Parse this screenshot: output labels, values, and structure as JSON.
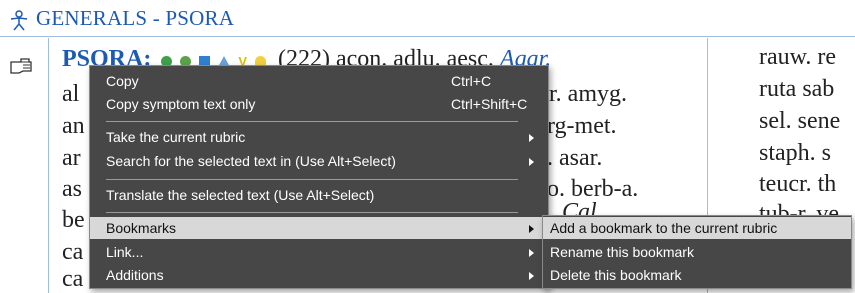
{
  "header": {
    "title": "GENERALS - PSORA",
    "icon": "human-figure-icon",
    "accent": "#1d5ab4"
  },
  "rubric": {
    "name": "PSORA:",
    "count": "(222)",
    "remedies_start": "acon. adlu. aesc.",
    "agar": "Agar."
  },
  "left_lines": {
    "l1_prefix": "al",
    "l1_suffix": "or. amyg.",
    "l2_prefix": "an",
    "l2_suffix": "rg-met.",
    "l3_prefix": "ar",
    "l3_suffix": ". asar.",
    "l4_prefix": "as",
    "l4_suffix": "o. berb-a.",
    "l5_prefix": "be",
    "l5_suffix": "Cal",
    "l6_prefix": "ca",
    "l7_prefix": "ca"
  },
  "right_lines": [
    "rauw. re",
    "ruta sab",
    "sel. sene",
    "staph. s",
    "teucr. th",
    "tub-r. ve"
  ],
  "context_menu": {
    "items": [
      {
        "label": "Copy",
        "shortcut": "Ctrl+C"
      },
      {
        "label": "Copy symptom text only",
        "shortcut": "Ctrl+Shift+C"
      },
      {
        "label": "Take the current rubric"
      },
      {
        "label": "Search for the selected text in (Use Alt+Select)"
      },
      {
        "label": "Translate the selected text (Use Alt+Select)"
      },
      {
        "label": "Bookmarks"
      },
      {
        "label": "Link..."
      },
      {
        "label": "Additions"
      }
    ]
  },
  "submenu": {
    "items": [
      {
        "label": "Add a bookmark to the current rubric"
      },
      {
        "label": "Rename this bookmark"
      },
      {
        "label": "Delete this bookmark"
      }
    ]
  },
  "colors": {
    "menu_bg": "#474747",
    "menu_highlight": "#d8d8d8",
    "link_blue": "#1d5ab4"
  }
}
